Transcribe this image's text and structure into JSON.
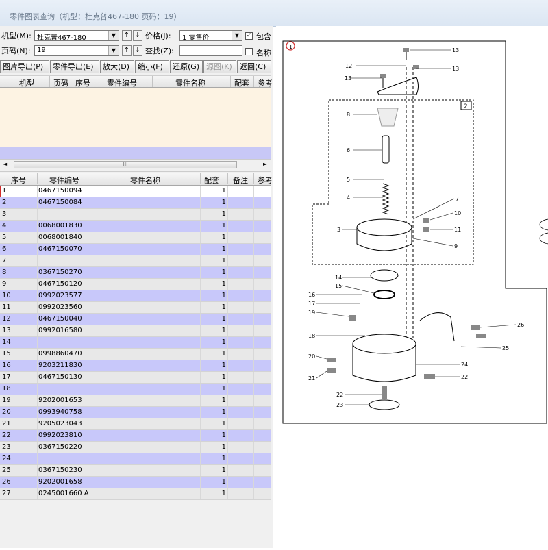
{
  "window": {
    "title": "零件图表查询（机型：杜克普467-180 页码：19）"
  },
  "filters": {
    "model_label": "机型(M):",
    "model_value": "杜克普467-180",
    "page_label": "页码(N):",
    "page_value": "19",
    "price_label": "价格(J):",
    "price_value": "1    零售价",
    "search_label": "查找(Z):",
    "search_value": "",
    "include_label": "包含",
    "include_checked": "✓",
    "name_label": "名称",
    "name_checked": ""
  },
  "toolbar": {
    "export_image": "图片导出(P)",
    "export_parts": "零件导出(E)",
    "zoom_in": "放大(D)",
    "zoom_out": "缩小(F)",
    "restore": "还原(G)",
    "source_image": "源图(K)",
    "back": "返回(C)"
  },
  "top_grid": {
    "columns": [
      "机型",
      "页码",
      "序号",
      "零件编号",
      "零件名称",
      "配套",
      "参考"
    ]
  },
  "hscroll": {
    "thumb": "III"
  },
  "parts_grid": {
    "columns": [
      "序号",
      "零件编号",
      "零件名称",
      "配套",
      "备注",
      "参考"
    ],
    "rows": [
      {
        "no": "1",
        "part": "0467150094",
        "qty": "1"
      },
      {
        "no": "2",
        "part": "0467150084",
        "qty": "1"
      },
      {
        "no": "3",
        "part": "",
        "qty": "1"
      },
      {
        "no": "4",
        "part": "0068001830",
        "qty": "1"
      },
      {
        "no": "5",
        "part": "0068001840",
        "qty": "1"
      },
      {
        "no": "6",
        "part": "0467150070",
        "qty": "1"
      },
      {
        "no": "7",
        "part": "",
        "qty": "1"
      },
      {
        "no": "8",
        "part": "0367150270",
        "qty": "1"
      },
      {
        "no": "9",
        "part": "0467150120",
        "qty": "1"
      },
      {
        "no": "10",
        "part": "0992023577",
        "qty": "1"
      },
      {
        "no": "11",
        "part": "0992023560",
        "qty": "1"
      },
      {
        "no": "12",
        "part": "0467150040",
        "qty": "1"
      },
      {
        "no": "13",
        "part": "0992016580",
        "qty": "1"
      },
      {
        "no": "14",
        "part": "",
        "qty": "1"
      },
      {
        "no": "15",
        "part": "0998860470",
        "qty": "1"
      },
      {
        "no": "16",
        "part": "9203211830",
        "qty": "1"
      },
      {
        "no": "17",
        "part": "0467150130",
        "qty": "1"
      },
      {
        "no": "18",
        "part": "",
        "qty": "1"
      },
      {
        "no": "19",
        "part": "9202001653",
        "qty": "1"
      },
      {
        "no": "20",
        "part": "0993940758",
        "qty": "1"
      },
      {
        "no": "21",
        "part": "9205023043",
        "qty": "1"
      },
      {
        "no": "22",
        "part": "0992023810",
        "qty": "1"
      },
      {
        "no": "23",
        "part": "0367150220",
        "qty": "1"
      },
      {
        "no": "24",
        "part": "",
        "qty": "1"
      },
      {
        "no": "25",
        "part": "0367150230",
        "qty": "1"
      },
      {
        "no": "26",
        "part": "9202001658",
        "qty": "1"
      },
      {
        "no": "27",
        "part": "0245001660 A",
        "qty": "1"
      }
    ]
  },
  "diagram": {
    "page_marker": "1",
    "sub_box": "2",
    "callouts": [
      "13",
      "12",
      "13",
      "13",
      "8",
      "6",
      "5",
      "4",
      "7",
      "10",
      "11",
      "3",
      "9",
      "14",
      "15",
      "16",
      "17",
      "19",
      "18",
      "20",
      "21",
      "26",
      "25",
      "24",
      "22",
      "22",
      "23"
    ]
  },
  "colors": {
    "row_odd": "#c8c8fa",
    "row_even": "#e8e8e8",
    "selected_outline": "#d12b2b",
    "top_grid_bg": "#fdf3e3"
  }
}
